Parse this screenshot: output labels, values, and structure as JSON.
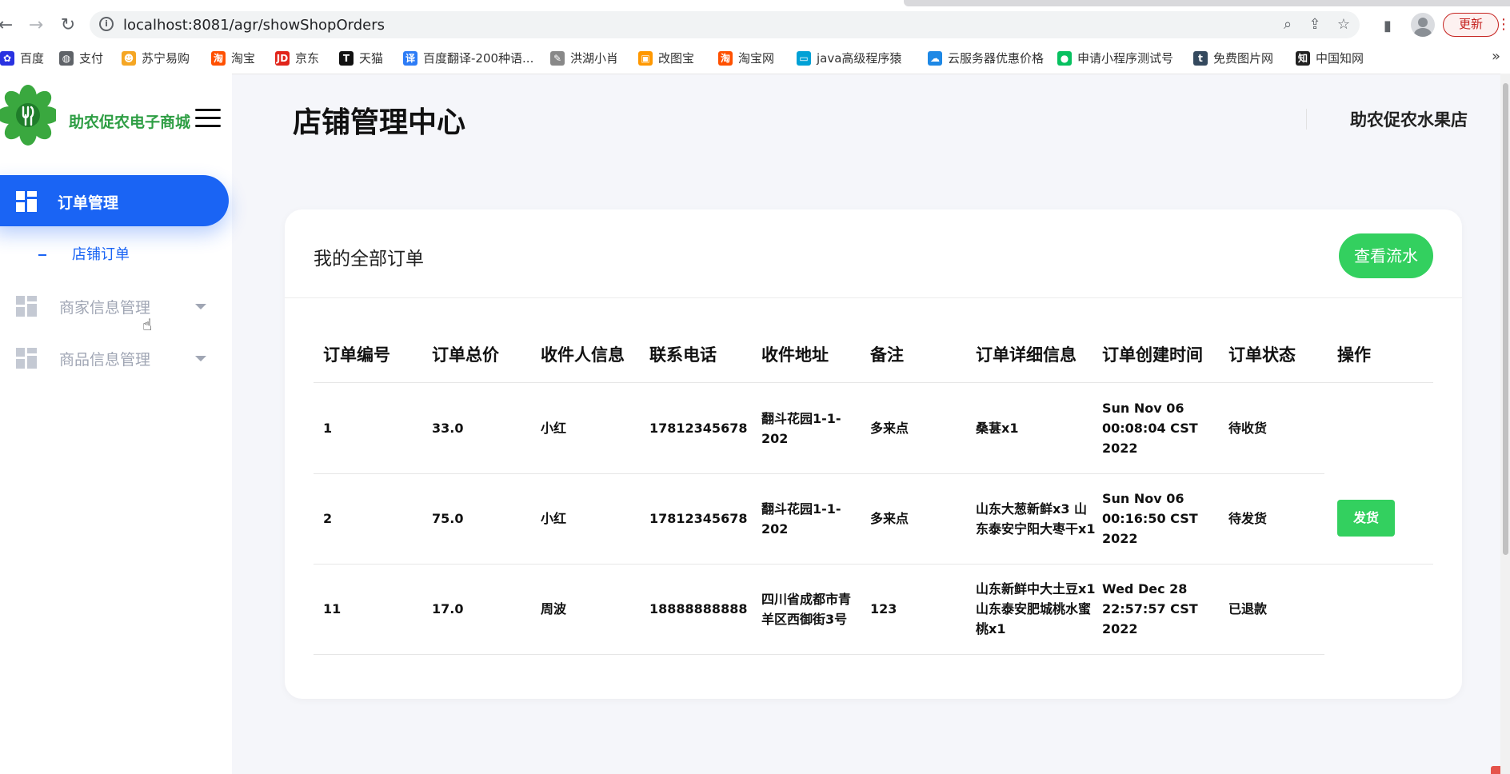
{
  "browser": {
    "url": "localhost:8081/agr/showShopOrders",
    "update_label": "更新",
    "bookmarks": [
      {
        "label": "百度",
        "icon": "baidu-icon",
        "color": "#2932e1"
      },
      {
        "label": "支付",
        "icon": "globe-icon",
        "color": "#5f6368"
      },
      {
        "label": "苏宁易购",
        "icon": "suning-icon",
        "color": "#f5a623"
      },
      {
        "label": "淘宝",
        "icon": "taobao-icon",
        "color": "#ff5000"
      },
      {
        "label": "京东",
        "icon": "jd-icon",
        "color": "#e1251b"
      },
      {
        "label": "天猫",
        "icon": "tmall-icon",
        "color": "#111111"
      },
      {
        "label": "百度翻译-200种语...",
        "icon": "translate-icon",
        "color": "#2d7cf6"
      },
      {
        "label": "洪湖小肖",
        "icon": "bird-icon",
        "color": "#888888"
      },
      {
        "label": "改图宝",
        "icon": "gaitubao-icon",
        "color": "#ff9800"
      },
      {
        "label": "淘宝网",
        "icon": "taobao-icon",
        "color": "#ff5000"
      },
      {
        "label": "java高级程序猿",
        "icon": "bilibili-icon",
        "color": "#00a1d6"
      },
      {
        "label": "云服务器优惠价格",
        "icon": "cloud-icon",
        "color": "#1e88e5"
      },
      {
        "label": "申请小程序测试号",
        "icon": "wechat-icon",
        "color": "#07c160"
      },
      {
        "label": "免费图片网",
        "icon": "t-icon",
        "color": "#34495e"
      },
      {
        "label": "中国知网",
        "icon": "cnki-icon",
        "color": "#222222"
      }
    ]
  },
  "sidebar": {
    "brand": "助农促农电子商城",
    "menu": [
      {
        "label": "订单管理",
        "active": true
      },
      {
        "label": "商家信息管理",
        "active": false
      },
      {
        "label": "商品信息管理",
        "active": false
      }
    ],
    "submenu": [
      {
        "label": "店铺订单"
      }
    ]
  },
  "header": {
    "title": "店铺管理中心",
    "shop_name": "助农促农水果店"
  },
  "orders": {
    "card_title": "我的全部订单",
    "flow_button": "查看流水",
    "columns": [
      "订单编号",
      "订单总价",
      "收件人信息",
      "联系电话",
      "收件地址",
      "备注",
      "订单详细信息",
      "订单创建时间",
      "订单状态",
      "操作"
    ],
    "rows": [
      {
        "id": "1",
        "total": "33.0",
        "recipient": "小红",
        "phone": "17812345678",
        "address": "翻斗花园1-1-202",
        "note": "多来点",
        "detail": "桑葚x1",
        "created": "Sun Nov 06 00:08:04 CST 2022",
        "status": "待收货",
        "action": ""
      },
      {
        "id": "2",
        "total": "75.0",
        "recipient": "小红",
        "phone": "17812345678",
        "address": "翻斗花园1-1-202",
        "note": "多来点",
        "detail": "山东大葱新鲜x3 山东泰安宁阳大枣干x1",
        "created": "Sun Nov 06 00:16:50 CST 2022",
        "status": "待发货",
        "action": "发货"
      },
      {
        "id": "11",
        "total": "17.0",
        "recipient": "周波",
        "phone": "18888888888",
        "address": "四川省成都市青羊区西御街3号",
        "note": "123",
        "detail": "山东新鲜中大土豆x1 山东泰安肥城桃水蜜桃x1",
        "created": "Wed Dec 28 22:57:57 CST 2022",
        "status": "已退款",
        "action": ""
      }
    ]
  },
  "colors": {
    "primary": "#1a64f4",
    "success": "#33d05f",
    "brand_green": "#2e9e44"
  }
}
